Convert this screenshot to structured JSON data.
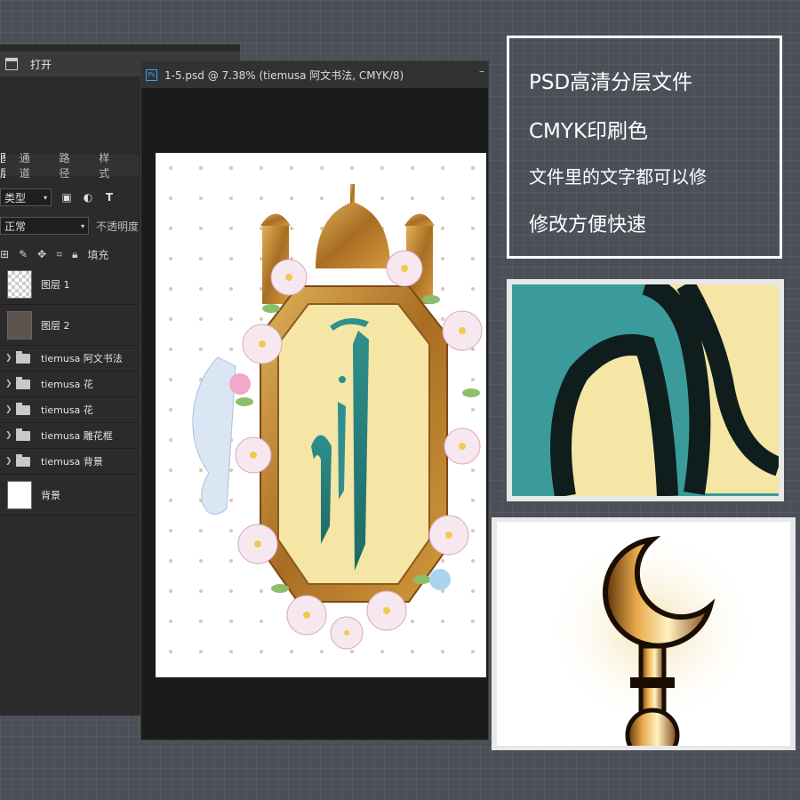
{
  "photoshop": {
    "open_label": "打开",
    "panel_tabs": [
      "图层",
      "通道",
      "路径",
      "样式"
    ],
    "filter_select": "类型",
    "blend_select": "正常",
    "opacity_label": "不透明度",
    "fill_label": "填充",
    "layers": [
      {
        "name": "图层 1",
        "kind": "layer",
        "thumb": "transparent"
      },
      {
        "name": "图层 2",
        "kind": "layer",
        "thumb": "photo"
      },
      {
        "name": "tiemusa 阿文书法",
        "kind": "group"
      },
      {
        "name": "tiemusa 花",
        "kind": "group"
      },
      {
        "name": "tiemusa 花",
        "kind": "group"
      },
      {
        "name": "tiemusa 雕花框",
        "kind": "group"
      },
      {
        "name": "tiemusa 背景",
        "kind": "group"
      },
      {
        "name": "背景",
        "kind": "layer",
        "thumb": "white"
      }
    ],
    "document_title": "1-5.psd @ 7.38% (tiemusa 阿文书法, CMYK/8)",
    "ps_badge": "Ps"
  },
  "info": {
    "line1": "PSD高清分层文件",
    "line2": "CMYK印刷色",
    "line3": "文件里的文字都可以修",
    "line4": "修改方便快速"
  },
  "colors": {
    "background": "#4b4f57",
    "teal": "#3b9b9a",
    "cream": "#f5e6a6",
    "gold": "#b9822e",
    "ps_blue": "#31a8ff"
  }
}
